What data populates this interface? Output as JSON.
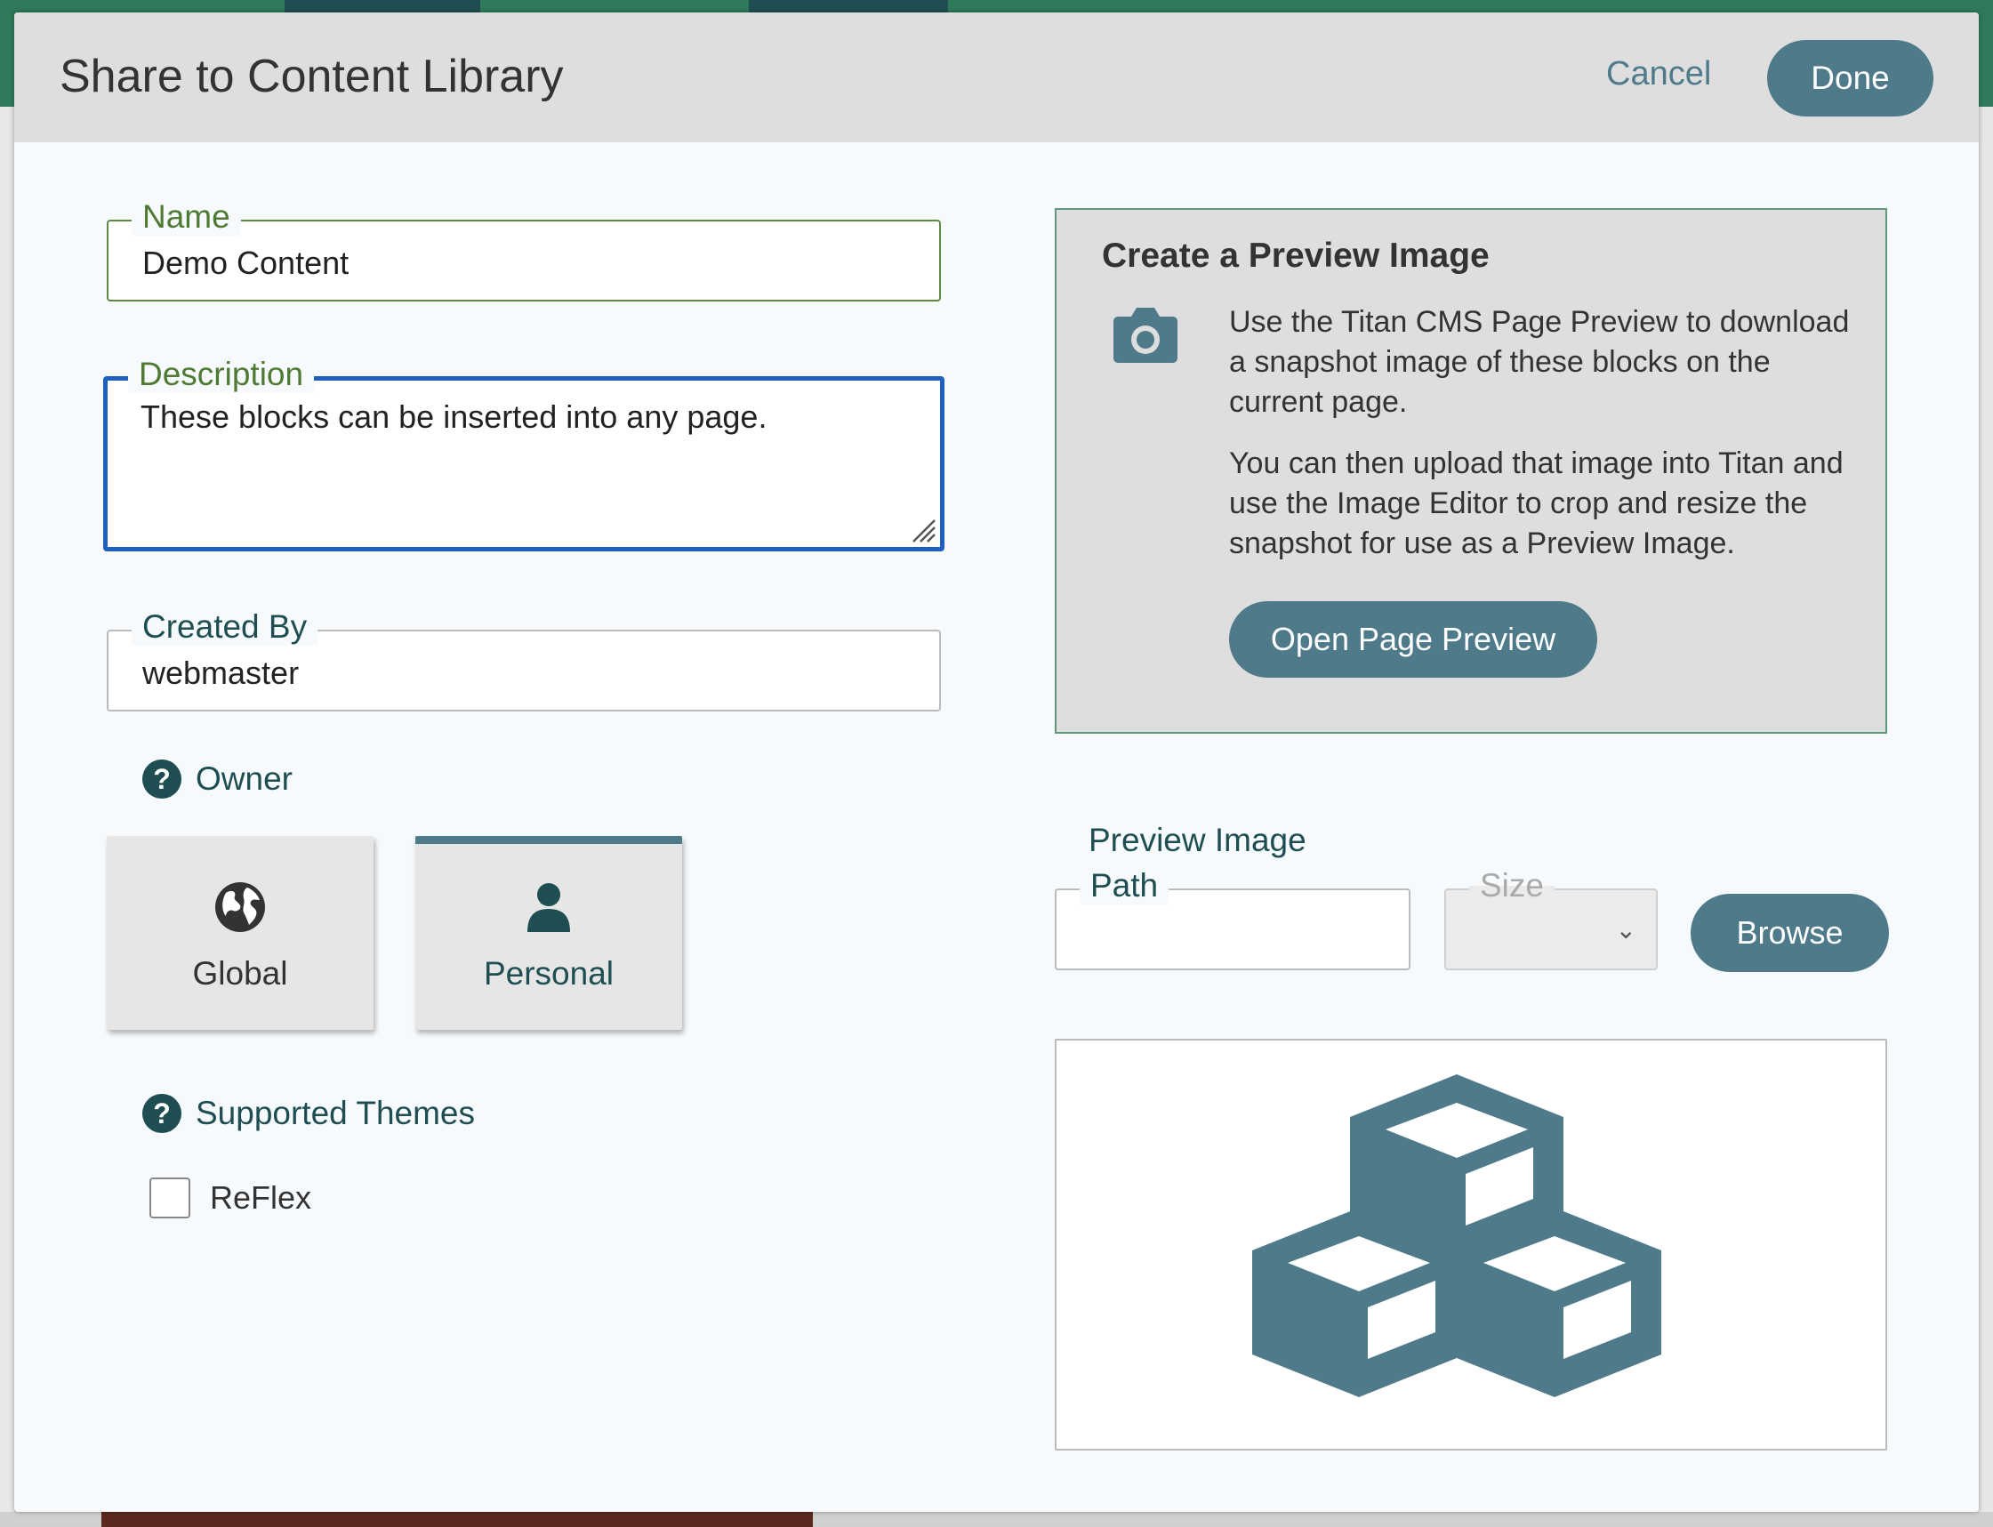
{
  "dialog": {
    "title": "Share to Content Library",
    "cancel_label": "Cancel",
    "done_label": "Done"
  },
  "form": {
    "name": {
      "label": "Name",
      "value": "Demo Content"
    },
    "description": {
      "label": "Description",
      "value": "These blocks can be inserted into any page."
    },
    "created_by": {
      "label": "Created By",
      "value": "webmaster"
    }
  },
  "owner": {
    "label": "Owner",
    "help_icon": "question-circle-icon",
    "options": [
      {
        "label": "Global",
        "icon": "globe-icon",
        "selected": false
      },
      {
        "label": "Personal",
        "icon": "user-icon",
        "selected": true
      }
    ]
  },
  "supported_themes": {
    "label": "Supported Themes",
    "help_icon": "question-circle-icon",
    "themes": [
      {
        "label": "ReFlex",
        "checked": false
      }
    ]
  },
  "preview_panel": {
    "title": "Create a Preview Image",
    "icon": "camera-icon",
    "paragraph1": "Use the Titan CMS Page Preview to download a snapshot image of these blocks on the current page.",
    "paragraph2": "You can then upload that image into Titan and use the Image Editor to crop and resize the snapshot for use as a Preview Image.",
    "button_label": "Open Page Preview"
  },
  "preview_image": {
    "label": "Preview Image",
    "path_label": "Path",
    "path_value": "",
    "size_label": "Size",
    "size_value": "",
    "browse_label": "Browse",
    "placeholder_icon": "cubes-icon"
  },
  "colors": {
    "accent": "#4e7a8a",
    "label_green": "#4f7a34",
    "label_dark": "#1f4e52",
    "focus_blue": "#1f5fbf"
  }
}
